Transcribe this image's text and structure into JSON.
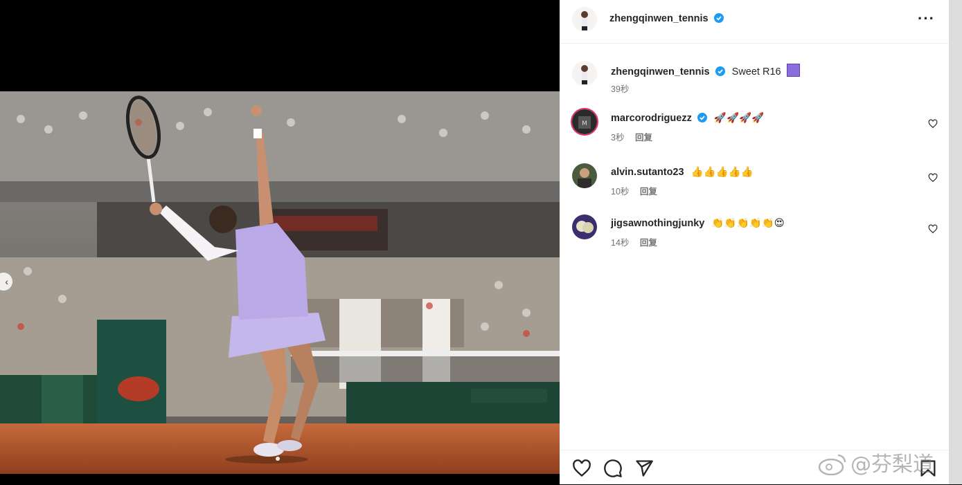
{
  "post": {
    "author": "zhengqinwen_tennis",
    "more_icon": "more-horizontal-icon"
  },
  "caption": {
    "author": "zhengqinwen_tennis",
    "text": "Sweet R16",
    "emoji": "purple-square",
    "time": "39秒"
  },
  "comments": [
    {
      "user": "marcorodriguezz",
      "verified": true,
      "text": "🚀🚀🚀🚀",
      "time": "3秒",
      "reply": "回复"
    },
    {
      "user": "alvin.sutanto23",
      "verified": false,
      "text": "👍👍👍👍👍",
      "time": "10秒",
      "reply": "回复"
    },
    {
      "user": "jigsawnothingjunky",
      "verified": false,
      "text": "👏👏👏👏👏😍",
      "time": "14秒",
      "reply": "回复"
    }
  ],
  "actions": [
    "like-icon",
    "comment-icon",
    "share-icon",
    "save-icon"
  ],
  "watermark": "@芬梨道",
  "colors": {
    "verified": "#1d9bf0",
    "court": "#b5532a",
    "dress": "#b9a9e6"
  }
}
